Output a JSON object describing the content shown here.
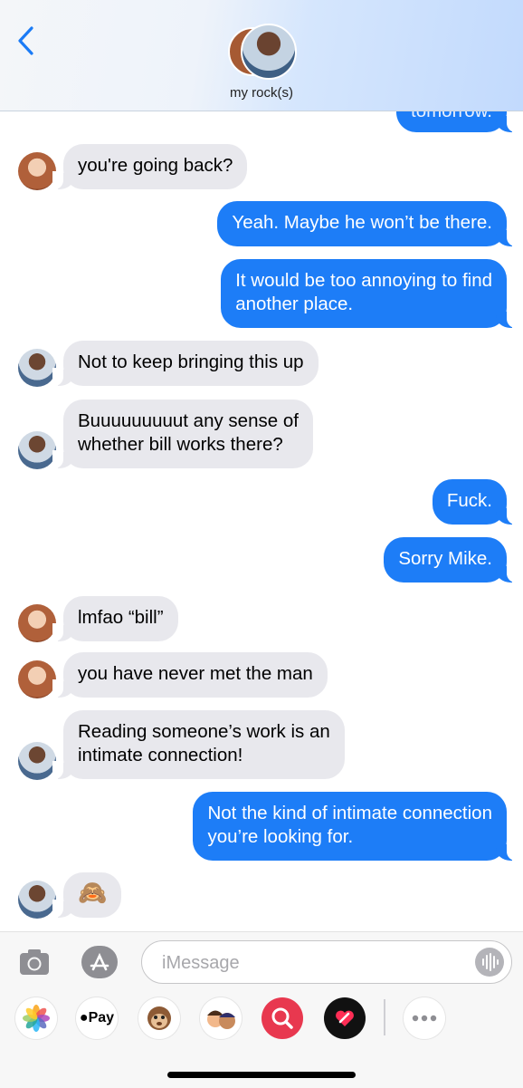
{
  "header": {
    "contact_name": "my rock(s)"
  },
  "messages": [
    {
      "side": "sent",
      "text": "tomorrow."
    },
    {
      "side": "recv",
      "sender": "her",
      "text": "you're going back?"
    },
    {
      "side": "sent",
      "text": "Yeah. Maybe he won’t be there."
    },
    {
      "side": "sent",
      "lines": [
        "It would be too annoying to find",
        "another place."
      ]
    },
    {
      "side": "recv",
      "sender": "him",
      "text": "Not to keep bringing this up"
    },
    {
      "side": "recv",
      "sender": "him",
      "lines": [
        "Buuuuuuuuut any sense of",
        "whether bill works there?"
      ]
    },
    {
      "side": "sent",
      "text": "Fuck."
    },
    {
      "side": "sent",
      "text": "Sorry Mike."
    },
    {
      "side": "recv",
      "sender": "her",
      "text": "lmfao “bill”"
    },
    {
      "side": "recv",
      "sender": "her",
      "text": "you have never met the man"
    },
    {
      "side": "recv",
      "sender": "him",
      "lines": [
        "Reading someone’s work is an",
        "intimate connection!"
      ]
    },
    {
      "side": "sent",
      "lines": [
        "Not the kind of intimate connection",
        "you’re looking for."
      ]
    },
    {
      "side": "recv",
      "sender": "him",
      "text": "🙈"
    }
  ],
  "compose": {
    "placeholder": "iMessage",
    "value": ""
  },
  "app_drawer": {
    "apple_pay_label": "Pay",
    "apps": [
      "photos-icon",
      "apple-pay-icon",
      "animoji-icon",
      "memoji-icon",
      "search-images-icon",
      "digital-touch-icon",
      "more-icon"
    ]
  },
  "colors": {
    "sent": "#1d7df7",
    "received": "#e8e8ed",
    "accent": "#1a7bf6"
  }
}
